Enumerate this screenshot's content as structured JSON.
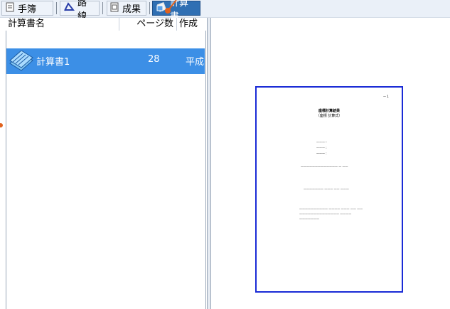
{
  "toolbar": {
    "tabs": [
      {
        "label": "手簿",
        "icon": "note-icon"
      },
      {
        "label": "路線",
        "icon": "route-icon"
      },
      {
        "label": "成果",
        "icon": "result-icon"
      },
      {
        "label": "計算書",
        "icon": "calc-report-icon",
        "active": true
      }
    ]
  },
  "list": {
    "headers": {
      "name": "計算書名",
      "pages": "ページ数",
      "created": "作成"
    },
    "rows": [
      {
        "name": "計算書1",
        "pages": "28",
        "created": "平成",
        "selected": true,
        "icon": "book-stack-icon"
      }
    ]
  },
  "preview": {
    "page_no": "— 1",
    "title": "座標計算結果",
    "subtitle": "（座標 計算式）",
    "lines": [
      "———   :",
      "———   :",
      "———   :",
      "—————————————   — ——",
      "———————   ——— —— ———",
      "——————————   ———— ———  ——  ——",
      "——————————————   ————",
      "———————"
    ]
  },
  "colors": {
    "accent": "#2f6fb3",
    "selection": "#3c8fe6",
    "page_border": "#1a2bd6",
    "pointer": "#e0621e"
  }
}
